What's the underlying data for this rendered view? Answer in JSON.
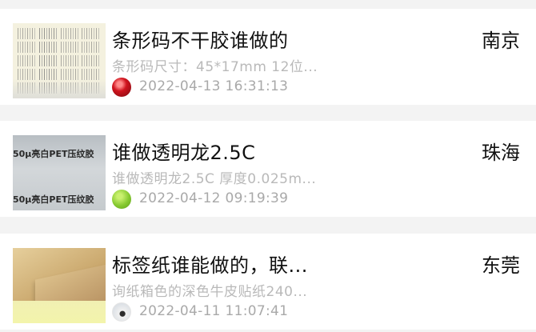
{
  "posts": [
    {
      "title": "条形码不干胶谁做的",
      "city": "南京",
      "description": "条形码尺寸：45*17mm 12位...",
      "timestamp": "2022-04-13 16:31:13",
      "thumbnail_icon": "barcode-sticker-sheet-image",
      "avatar_icon": "red-gem-avatar"
    },
    {
      "title": "谁做透明龙2.5C",
      "city": "珠海",
      "description": "谁做透明龙2.5C 厚度0.025m...",
      "timestamp": "2022-04-12 09:19:39",
      "thumbnail_icon": "pet-film-image",
      "thumbnail_text": "50μ亮白PET压纹胶",
      "avatar_icon": "green-ball-avatar"
    },
    {
      "title": "标签纸谁能做的，联...",
      "city": "东莞",
      "description": "询纸箱色的深色牛皮贴纸240...",
      "timestamp": "2022-04-11 11:07:41",
      "thumbnail_icon": "kraft-paper-label-image",
      "avatar_icon": "monochrome-avatar"
    }
  ],
  "colors": {
    "page_background": "#f3f3f3",
    "card_background": "#ffffff",
    "title_text": "#111111",
    "secondary_text": "#b9b9b9"
  }
}
